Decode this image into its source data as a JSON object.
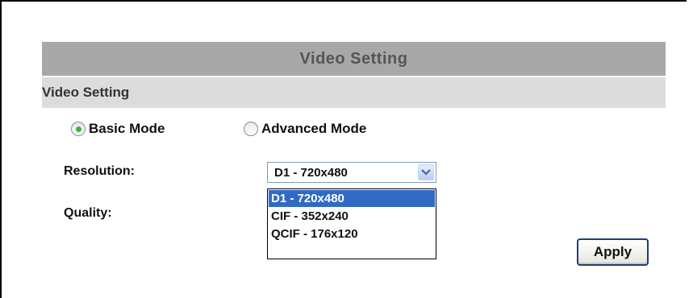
{
  "panel": {
    "title": "Video Setting",
    "section_label": "Video Setting"
  },
  "mode": {
    "options": [
      {
        "label": "Basic Mode",
        "checked": true
      },
      {
        "label": "Advanced Mode",
        "checked": false
      }
    ]
  },
  "resolution": {
    "label": "Resolution:",
    "selected": "D1 - 720x480",
    "options": [
      "D1 - 720x480",
      "CIF - 352x240",
      "QCIF - 176x120"
    ]
  },
  "quality": {
    "label": "Quality:"
  },
  "actions": {
    "apply_label": "Apply"
  },
  "colors": {
    "header_bg": "#a8a8a8",
    "subheader_bg": "#dcdcdc",
    "selected_bg": "#316ac5",
    "radio_dot": "#3ab53a"
  },
  "icons": {
    "dropdown_arrow": "chevron-down-icon"
  }
}
